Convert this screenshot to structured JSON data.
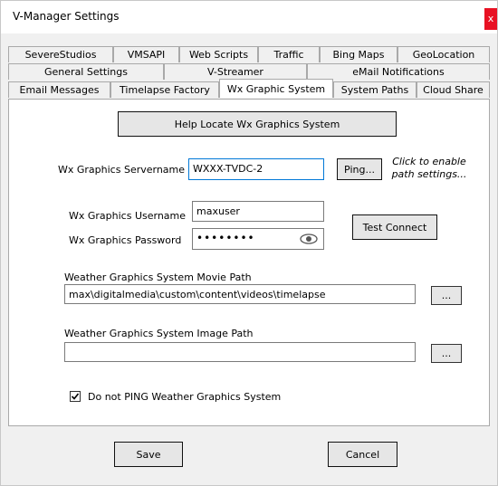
{
  "window": {
    "title": "V-Manager Settings",
    "close_label": "x"
  },
  "tabs": {
    "row1": [
      "SevereStudios",
      "VMSAPI",
      "Web Scripts",
      "Traffic",
      "Bing Maps",
      "GeoLocation"
    ],
    "row2": [
      "General Settings",
      "V-Streamer",
      "eMail Notifications"
    ],
    "row3": [
      "Email Messages",
      "Timelapse Factory",
      "Wx Graphic System",
      "System Paths",
      "Cloud Share"
    ],
    "active": "Wx Graphic System"
  },
  "panel": {
    "help_button": "Help Locate Wx Graphics System",
    "servername_label": "Wx Graphics Servername",
    "servername_value": "WXXX-TVDC-2",
    "ping_button": "Ping...",
    "ping_hint_line1": "Click to enable",
    "ping_hint_line2": "path settings...",
    "username_label": "Wx Graphics Username",
    "username_value": "maxuser",
    "password_label": "Wx Graphics Password",
    "password_value": "••••••••",
    "test_connect_button": "Test Connect",
    "movie_path_label": "Weather Graphics System Movie Path",
    "movie_path_value": "max\\digitalmedia\\custom\\content\\videos\\timelapse",
    "movie_browse_button": "...",
    "image_path_label": "Weather Graphics System Image Path",
    "image_path_value": "",
    "image_browse_button": "...",
    "no_ping_label": "Do not PING Weather Graphics System",
    "no_ping_checked": true
  },
  "footer": {
    "save_button": "Save",
    "cancel_button": "Cancel"
  }
}
